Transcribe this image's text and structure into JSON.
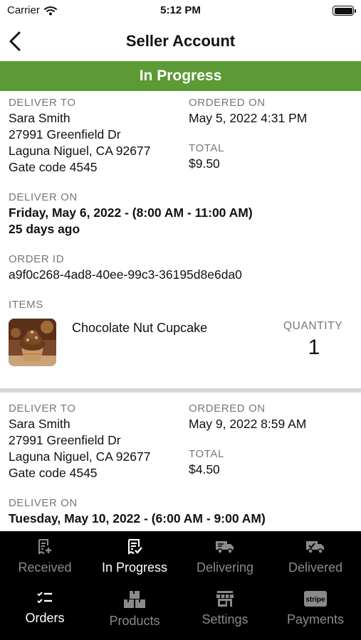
{
  "status_bar": {
    "carrier": "Carrier",
    "time": "5:12 PM",
    "wifi_icon": "wifi-icon",
    "battery_icon": "battery-icon"
  },
  "nav": {
    "title": "Seller Account",
    "back_icon": "chevron-left-icon"
  },
  "banner": {
    "text": "In Progress",
    "color": "#5b9a35"
  },
  "orders": [
    {
      "deliver_to_label": "DELIVER TO",
      "name": "Sara Smith",
      "street": "27991 Greenfield Dr",
      "city": "Laguna Niguel, CA 92677",
      "gate": "Gate code 4545",
      "ordered_on_label": "ORDERED ON",
      "ordered_on": "May 5, 2022 4:31 PM",
      "total_label": "TOTAL",
      "total": "$9.50",
      "deliver_on_label": "DELIVER ON",
      "deliver_on": "Friday, May 6, 2022 - (8:00 AM - 11:00 AM)",
      "relative": "25 days ago",
      "order_id_label": "ORDER ID",
      "order_id": "a9f0c268-4ad8-40ee-99c3-36195d8e6da0",
      "items_label": "ITEMS",
      "item_name": "Chocolate Nut Cupcake",
      "quantity_label": "QUANTITY",
      "quantity": "1"
    },
    {
      "deliver_to_label": "DELIVER TO",
      "name": "Sara Smith",
      "street": "27991 Greenfield Dr",
      "city": "Laguna Niguel, CA 92677",
      "gate": "Gate code 4545",
      "ordered_on_label": "ORDERED ON",
      "ordered_on": "May 9, 2022 8:59 AM",
      "total_label": "TOTAL",
      "total": "$4.50",
      "deliver_on_label": "DELIVER ON",
      "deliver_on": "Tuesday, May 10, 2022 - (6:00 AM - 9:00 AM)"
    }
  ],
  "status_tabs": [
    {
      "label": "Received",
      "icon": "receipt-plus-icon",
      "active": false
    },
    {
      "label": "In Progress",
      "icon": "receipt-check-icon",
      "active": true
    },
    {
      "label": "Delivering",
      "icon": "delivery-truck-icon",
      "active": false
    },
    {
      "label": "Delivered",
      "icon": "truck-check-icon",
      "active": false
    }
  ],
  "main_tabs": [
    {
      "label": "Orders",
      "icon": "checklist-icon",
      "active": true
    },
    {
      "label": "Products",
      "icon": "boxes-icon",
      "active": false
    },
    {
      "label": "Settings",
      "icon": "storefront-icon",
      "active": false
    },
    {
      "label": "Payments",
      "icon": "stripe-icon",
      "active": false
    }
  ],
  "stripe_badge": "stripe"
}
